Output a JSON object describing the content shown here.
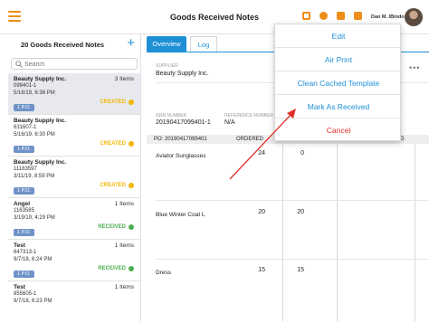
{
  "header": {
    "title": "Goods Received Notes",
    "user": "Dan M. IBindo",
    "accent": "#f08c1a"
  },
  "left": {
    "title": "20 Goods Received Notes",
    "add": "+",
    "search_placeholder": "Search",
    "items": [
      {
        "name": "Beauty Supply Inc.",
        "id": "099401-1",
        "date": "5/16/19, 6:38 PM",
        "count": "3 Items",
        "po": "1 P.O.",
        "status": "CREATED",
        "status_color": "#f2b705"
      },
      {
        "name": "Beauty Supply Inc.",
        "id": "631607-1",
        "date": "5/16/19, 6:30 PM",
        "count": "",
        "po": "1 P.O.",
        "status": "CREATED",
        "status_color": "#f2b705"
      },
      {
        "name": "Beauty Supply Inc.",
        "id": "11183597",
        "date": "3/11/19, 8:59 PM",
        "count": "",
        "po": "1 P.O.",
        "status": "CREATED",
        "status_color": "#f2b705"
      },
      {
        "name": "Angel",
        "id": "1163585",
        "date": "3/19/19, 4:29 PM",
        "count": "1 Items",
        "po": "1 P.O.",
        "status": "RECEIVED",
        "status_color": "#4caf50"
      },
      {
        "name": "Test",
        "id": "647313-1",
        "date": "9/7/18, 6:24 PM",
        "count": "1 Items",
        "po": "1 P.O.",
        "status": "RECEIVED",
        "status_color": "#4caf50"
      },
      {
        "name": "Test",
        "id": "855605-1",
        "date": "9/7/18, 6:23 PM",
        "count": "1 Items",
        "po": "",
        "status": "",
        "status_color": ""
      }
    ]
  },
  "tabs": {
    "overview": "Overview",
    "log": "Log"
  },
  "detail": {
    "supplier_label": "SUPPLIER",
    "supplier": "Beauty Supply Inc.",
    "grn_label": "GRN NUMBER",
    "grn": "20190417099401-1",
    "ref_label": "REFERENCE NUMBER",
    "ref": "N/A",
    "po_line": "PO: 20190417099401",
    "ordered": "ORDERED",
    "g_col": "G",
    "rows": [
      {
        "name": "Aviator Sunglasses",
        "ordered": "24",
        "received": "0"
      },
      {
        "name": "Blue Winter Coat L",
        "ordered": "20",
        "received": "20"
      },
      {
        "name": "Dress",
        "ordered": "15",
        "received": "15"
      }
    ]
  },
  "menu": {
    "items": [
      "Edit",
      "Air Print",
      "Clean Cached Template",
      "Mark As Received",
      "Cancel"
    ],
    "link_color": "#1e90d6",
    "danger_color": "#e0312b"
  },
  "more": "•••"
}
